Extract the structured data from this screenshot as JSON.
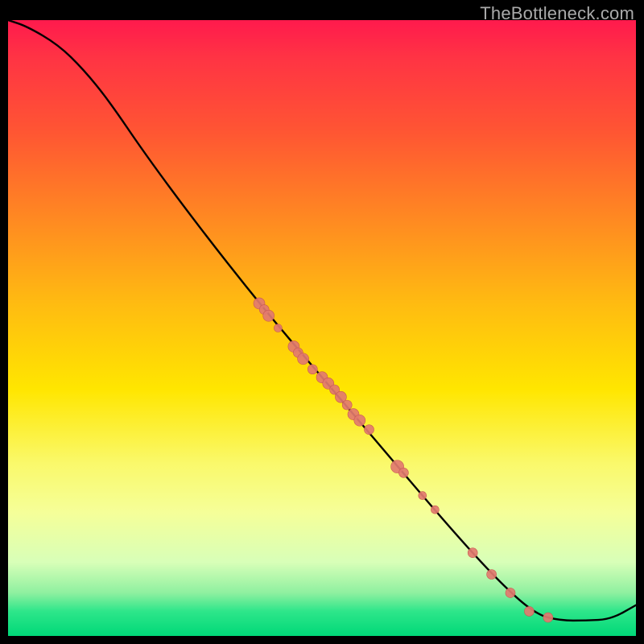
{
  "watermark": "TheBottleneck.com",
  "colors": {
    "curve": "#000000",
    "marker_fill": "#e27a6f",
    "marker_stroke": "#c85a50"
  },
  "chart_data": {
    "type": "line",
    "title": "",
    "xlabel": "",
    "ylabel": "",
    "xlim": [
      0,
      100
    ],
    "ylim": [
      0,
      100
    ],
    "curve": [
      {
        "x": 0,
        "y": 100
      },
      {
        "x": 3,
        "y": 99
      },
      {
        "x": 8,
        "y": 96
      },
      {
        "x": 12,
        "y": 92
      },
      {
        "x": 16,
        "y": 87
      },
      {
        "x": 22,
        "y": 78
      },
      {
        "x": 30,
        "y": 67
      },
      {
        "x": 40,
        "y": 54
      },
      {
        "x": 50,
        "y": 42
      },
      {
        "x": 60,
        "y": 30
      },
      {
        "x": 70,
        "y": 18
      },
      {
        "x": 78,
        "y": 9
      },
      {
        "x": 84,
        "y": 3.5
      },
      {
        "x": 88,
        "y": 2.5
      },
      {
        "x": 92,
        "y": 2.5
      },
      {
        "x": 96,
        "y": 2.7
      },
      {
        "x": 100,
        "y": 5
      }
    ],
    "markers": [
      {
        "x": 40.0,
        "y": 54.0,
        "r": 7
      },
      {
        "x": 40.8,
        "y": 53.0,
        "r": 6
      },
      {
        "x": 41.5,
        "y": 52.0,
        "r": 7
      },
      {
        "x": 43.0,
        "y": 50.0,
        "r": 5
      },
      {
        "x": 45.5,
        "y": 47.0,
        "r": 7
      },
      {
        "x": 46.2,
        "y": 46.0,
        "r": 6
      },
      {
        "x": 47.0,
        "y": 45.0,
        "r": 7
      },
      {
        "x": 48.5,
        "y": 43.3,
        "r": 6
      },
      {
        "x": 50.0,
        "y": 42.0,
        "r": 7
      },
      {
        "x": 51.0,
        "y": 41.0,
        "r": 7
      },
      {
        "x": 52.0,
        "y": 40.0,
        "r": 6
      },
      {
        "x": 53.0,
        "y": 38.8,
        "r": 7
      },
      {
        "x": 54.0,
        "y": 37.5,
        "r": 6
      },
      {
        "x": 55.0,
        "y": 36.0,
        "r": 7
      },
      {
        "x": 56.0,
        "y": 35.0,
        "r": 7
      },
      {
        "x": 57.5,
        "y": 33.5,
        "r": 6
      },
      {
        "x": 62.0,
        "y": 27.5,
        "r": 8
      },
      {
        "x": 63.0,
        "y": 26.5,
        "r": 6
      },
      {
        "x": 66.0,
        "y": 22.8,
        "r": 5
      },
      {
        "x": 68.0,
        "y": 20.5,
        "r": 5
      },
      {
        "x": 74.0,
        "y": 13.5,
        "r": 6
      },
      {
        "x": 77.0,
        "y": 10.0,
        "r": 6
      },
      {
        "x": 80.0,
        "y": 7.0,
        "r": 6
      },
      {
        "x": 83.0,
        "y": 4.0,
        "r": 6
      },
      {
        "x": 86.0,
        "y": 3.0,
        "r": 6
      }
    ]
  }
}
